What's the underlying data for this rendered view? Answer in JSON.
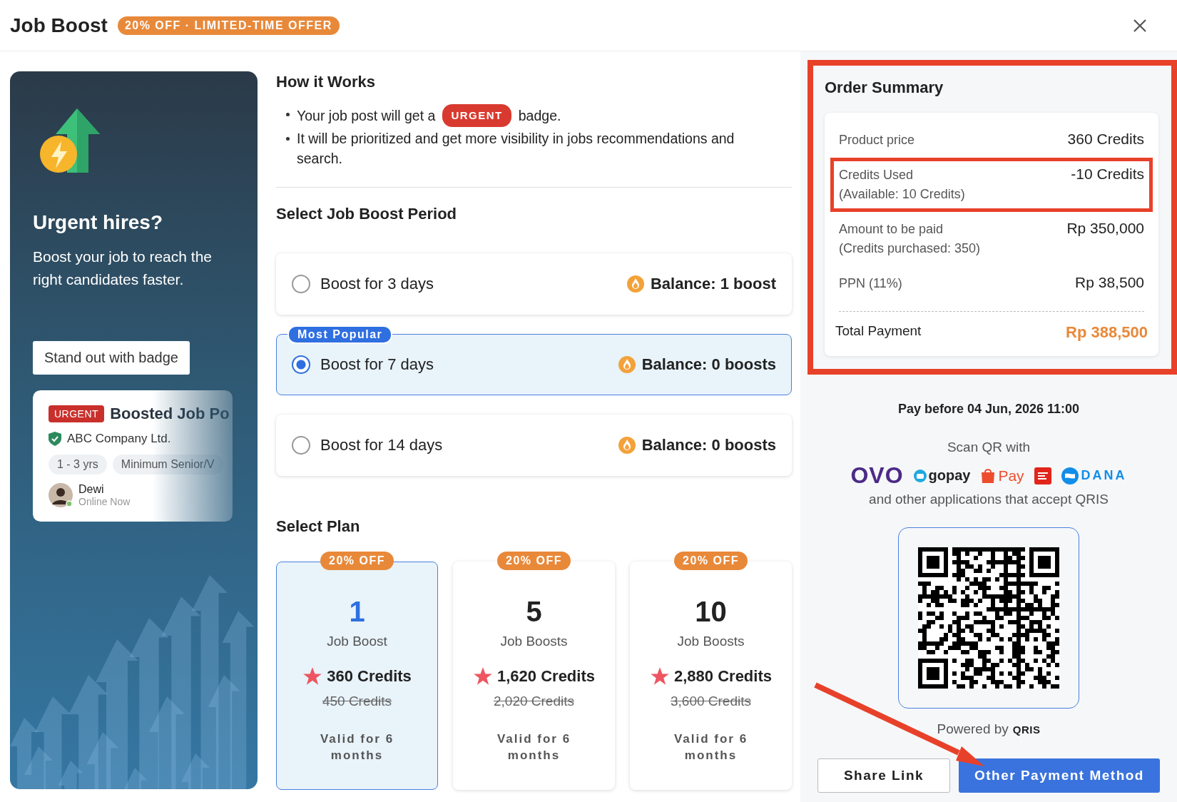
{
  "header": {
    "title": "Job Boost",
    "badge": "20% OFF · LIMITED-TIME OFFER"
  },
  "promo": {
    "heading": "Urgent hires?",
    "text": "Boost your job to reach the right candidates faster.",
    "tooltip": "Stand out with badge",
    "job_card": {
      "badge": "URGENT",
      "title": "Boosted Job Po",
      "company": "ABC Company Ltd.",
      "tags": [
        "1 - 3 yrs",
        "Minimum Senior/V"
      ],
      "user": "Dewi",
      "status": "Online Now"
    }
  },
  "how_it_works": {
    "title": "How it Works",
    "bullets": [
      {
        "kind": "badge",
        "before": "Your job post will get a",
        "badge": "URGENT",
        "after": "badge."
      },
      {
        "kind": "text",
        "text": "It will be prioritized and get more visibility in jobs recommendations and search."
      }
    ]
  },
  "period": {
    "title": "Select Job Boost Period",
    "options": [
      {
        "label": "Boost for 3 days",
        "balance": "Balance: 1 boost",
        "selected": false
      },
      {
        "label": "Boost for 7 days",
        "balance": "Balance: 0 boosts",
        "selected": true,
        "tag": "Most Popular"
      },
      {
        "label": "Boost for 14 days",
        "balance": "Balance: 0 boosts",
        "selected": false
      }
    ]
  },
  "plan": {
    "title": "Select Plan",
    "items": [
      {
        "discount": "20% OFF",
        "count": "1",
        "unit": "Job Boost",
        "price": "360 Credits",
        "old_price": "450 Credits",
        "validity": "Valid for 6 months",
        "selected": true
      },
      {
        "discount": "20% OFF",
        "count": "5",
        "unit": "Job Boosts",
        "price": "1,620 Credits",
        "old_price": "2,020 Credits",
        "validity": "Valid for 6 months",
        "selected": false
      },
      {
        "discount": "20% OFF",
        "count": "10",
        "unit": "Job Boosts",
        "price": "2,880 Credits",
        "old_price": "3,600 Credits",
        "validity": "Valid for 6 months",
        "selected": false
      }
    ]
  },
  "order_summary": {
    "title": "Order Summary",
    "highlighted": true,
    "rows": [
      {
        "label": "Product price",
        "value": "360 Credits",
        "highlighted": false
      },
      {
        "label": "Credits Used",
        "sublabel": "(Available: 10 Credits)",
        "value": "-10 Credits",
        "highlighted": true
      },
      {
        "label": "Amount to be paid",
        "sublabel": "(Credits purchased: 350)",
        "value": "Rp 350,000",
        "highlighted": false
      },
      {
        "label": "PPN (11%)",
        "value": "Rp 38,500",
        "highlighted": false
      }
    ],
    "total": {
      "label": "Total Payment",
      "value": "Rp 388,500"
    }
  },
  "payment": {
    "deadline": "Pay before 04 Jun, 2026 11:00",
    "scan": "Scan QR with",
    "apps": [
      {
        "kind": "ovo",
        "text": "OVO"
      },
      {
        "kind": "gopay",
        "text": "gopay"
      },
      {
        "kind": "shopeepay",
        "text": "Pay"
      },
      {
        "kind": "linkaja"
      },
      {
        "kind": "dana",
        "text": "DANA"
      }
    ],
    "accept": "and other applications that accept QRIS",
    "powered_by": "Powered by",
    "qris": "QRIS",
    "buttons": [
      {
        "kind": "secondary",
        "label": "Share Link"
      },
      {
        "kind": "primary",
        "label": "Other Payment Method"
      }
    ]
  }
}
